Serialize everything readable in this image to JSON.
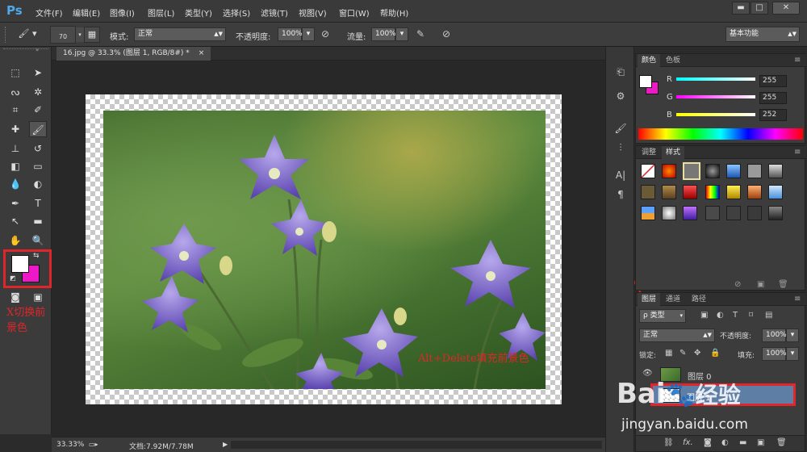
{
  "app": {
    "logo": "Ps"
  },
  "menu": [
    "文件(F)",
    "编辑(E)",
    "图像(I)",
    "图层(L)",
    "类型(Y)",
    "选择(S)",
    "滤镜(T)",
    "视图(V)",
    "窗口(W)",
    "帮助(H)"
  ],
  "window_buttons": [
    "▬",
    "□",
    "✕"
  ],
  "options": {
    "brush_size": "70",
    "mode_label": "模式:",
    "mode_value": "正常",
    "opacity_label": "不透明度:",
    "opacity_value": "100%",
    "flow_label": "流量:",
    "flow_value": "100%",
    "workspace": "基本功能"
  },
  "document": {
    "tab": "16.jpg @ 33.3% (图层 1, RGB/8#) *",
    "tab_close": "×"
  },
  "status": {
    "zoom": "33.33%",
    "doc_size": "文档:7.92M/7.78M"
  },
  "annotations": {
    "left": "X切换前景色",
    "center": "Alt+Delete填充前景色"
  },
  "color_panel": {
    "tabs": [
      "颜色",
      "色板"
    ],
    "channels": [
      {
        "label": "R",
        "value": "255"
      },
      {
        "label": "G",
        "value": "255"
      },
      {
        "label": "B",
        "value": "252"
      }
    ]
  },
  "styles_panel": {
    "tabs": [
      "调整",
      "样式"
    ]
  },
  "layers_panel": {
    "tabs": [
      "图层",
      "通道",
      "路径"
    ],
    "filter": "ρ 类型",
    "blend_mode": "正常",
    "opacity_label": "不透明度:",
    "opacity_value": "100%",
    "lock_label": "锁定:",
    "fill_label": "填充:",
    "fill_value": "100%",
    "layers": [
      {
        "name": "图层 0"
      },
      {
        "name": "图层 1"
      }
    ],
    "footer_fx": "fx."
  },
  "colors": {
    "foreground": "#ffffff",
    "background": "#ee18c9",
    "highlight": "#e0262a",
    "annotation_text": "#e0262a"
  },
  "watermark": {
    "brand": "Bai",
    "brand2": "经验",
    "url": "jingyan.baidu.com"
  }
}
